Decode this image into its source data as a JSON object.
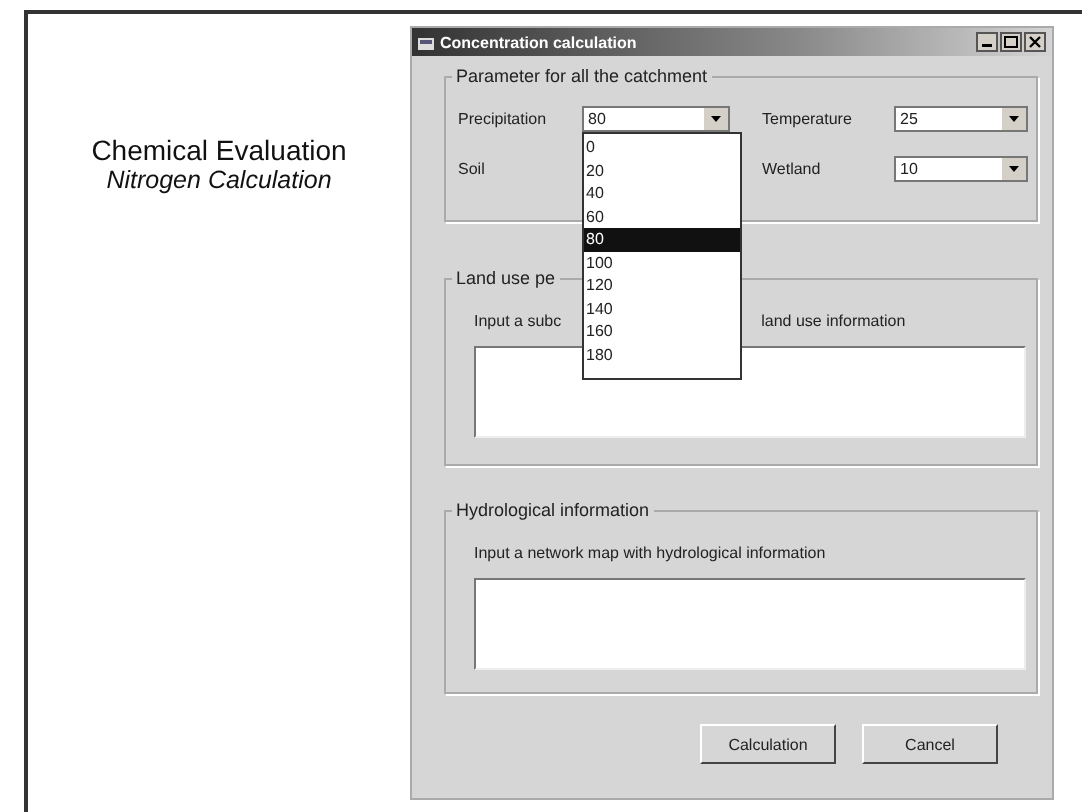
{
  "caption": {
    "title": "Chemical Evaluation",
    "subtitle": "Nitrogen Calculation"
  },
  "window": {
    "title": "Concentration calculation"
  },
  "parameters": {
    "title": "Parameter for all the catchment",
    "fields": [
      {
        "label": "Precipitation",
        "value": "80",
        "open": true
      },
      {
        "label": "Temperature",
        "value": "25",
        "open": false
      },
      {
        "label": "Soil"
      },
      {
        "label": "Wetland",
        "value": "10",
        "open": false
      }
    ]
  },
  "dropdown": {
    "items": [
      {
        "label": "0",
        "selected": false
      },
      {
        "label": "20",
        "selected": false
      },
      {
        "label": "40",
        "selected": false
      },
      {
        "label": "60",
        "selected": false
      },
      {
        "label": "80",
        "selected": true
      },
      {
        "label": "100",
        "selected": false
      },
      {
        "label": "120",
        "selected": false
      },
      {
        "label": "140",
        "selected": false
      },
      {
        "label": "160",
        "selected": false
      },
      {
        "label": "180",
        "selected": false
      }
    ]
  },
  "land_use": {
    "title": "Land use pe",
    "hint_parts": [
      "Input a subc",
      "land use information"
    ]
  },
  "hydrology": {
    "title": "Hydrological information",
    "hint": "Input a network map with hydrological information"
  },
  "buttons": [
    {
      "label": "Calculation"
    },
    {
      "label": "Cancel"
    }
  ]
}
